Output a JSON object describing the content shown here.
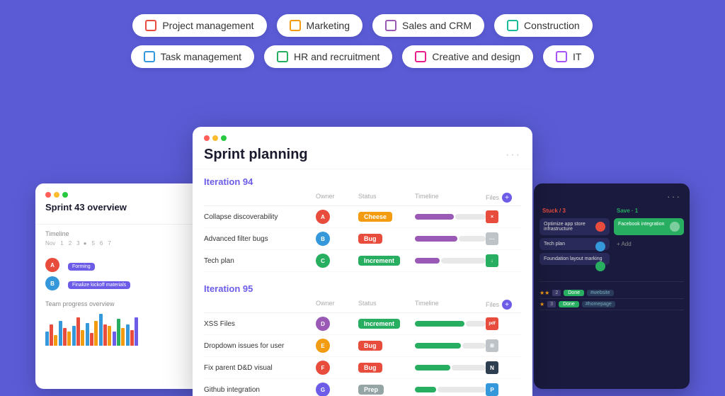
{
  "pills": {
    "row1": [
      {
        "id": "project-management",
        "label": "Project management",
        "color": "red"
      },
      {
        "id": "marketing",
        "label": "Marketing",
        "color": "orange"
      },
      {
        "id": "sales-crm",
        "label": "Sales and CRM",
        "color": "purple"
      },
      {
        "id": "construction",
        "label": "Construction",
        "color": "teal"
      }
    ],
    "row2": [
      {
        "id": "task-management",
        "label": "Task management",
        "color": "blue"
      },
      {
        "id": "hr-recruitment",
        "label": "HR and recruitment",
        "color": "green"
      },
      {
        "id": "creative-design",
        "label": "Creative and design",
        "color": "pink"
      },
      {
        "id": "it",
        "label": "IT",
        "color": "lavender"
      }
    ]
  },
  "left_card": {
    "title": "Sprint 43 overview",
    "timeline_label": "Timeline",
    "row1_label": "Forming",
    "row2_label": "Finalize kickoff materials",
    "team_label": "Team progress overview"
  },
  "center_card": {
    "title": "Sprint planning",
    "iteration1": {
      "title": "Iteration 94",
      "columns": [
        "",
        "Owner",
        "Status",
        "Timeline",
        "Files"
      ],
      "rows": [
        {
          "name": "Collapse discoverability",
          "status": "Cheese",
          "status_class": "status-cheese",
          "tl_pct": 55,
          "file_class": "file-red",
          "file_text": "×"
        },
        {
          "name": "Advanced filter bugs",
          "status": "Bug",
          "status_class": "status-bug",
          "tl_pct": 60,
          "file_class": "file-gray",
          "file_text": "···"
        },
        {
          "name": "Tech plan",
          "status": "Increment",
          "status_class": "status-increment",
          "tl_pct": 35,
          "file_class": "file-green",
          "file_text": "↓"
        }
      ]
    },
    "iteration2": {
      "title": "Iteration 95",
      "columns": [
        "",
        "Owner",
        "Status",
        "Timeline",
        "Files"
      ],
      "rows": [
        {
          "name": "XSS Files",
          "status": "Increment",
          "status_class": "status-increment",
          "tl_pct": 70,
          "file_class": "file-red",
          "file_text": "pdf"
        },
        {
          "name": "Dropdown issues for user",
          "status": "Bug",
          "status_class": "status-bug",
          "tl_pct": 65,
          "file_class": "file-gray",
          "file_text": "⊞"
        },
        {
          "name": "Fix parent D&D visual",
          "status": "Bug",
          "status_class": "status-bug",
          "tl_pct": 50,
          "file_class": "file-navy",
          "file_text": "N"
        },
        {
          "name": "Github integration",
          "status": "Prep",
          "status_class": "status-prep",
          "tl_pct": 30,
          "file_class": "file-blue",
          "file_text": "P"
        }
      ]
    }
  },
  "right_card": {
    "stuck_label": "Stuck / 3",
    "save_label": "Save · 1",
    "cards": [
      {
        "text": "Optimize app store infrastructure",
        "col": "stuck"
      },
      {
        "text": "Tech plan",
        "col": "stuck"
      },
      {
        "text": "Foundation layout marking",
        "col": "stuck"
      },
      {
        "text": "Facebook integration",
        "col": "save"
      }
    ],
    "bottom_label": "#website",
    "bottom_label2": "#homepage"
  }
}
